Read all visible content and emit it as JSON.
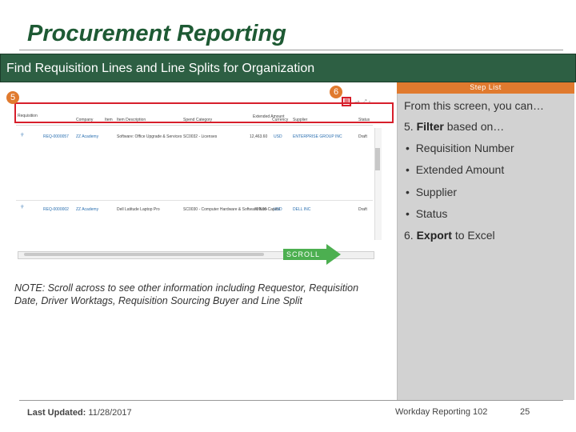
{
  "slide": {
    "title": "Procurement Reporting",
    "banner": "Find Requisition Lines and Line Splits for Organization",
    "step_list_label": "Step List",
    "markers": {
      "five": "5",
      "six": "6"
    },
    "scroll_label": "SCROLL",
    "note": "NOTE: Scroll across to see other information including Requestor, Requisition Date, Driver Worktags, Requisition  Sourcing Buyer and Line Split",
    "footer": {
      "updated_label": "Last Updated:",
      "updated_date": "11/28/2017",
      "course": "Workday Reporting 102",
      "page": "25"
    }
  },
  "steps": {
    "intro": "From this screen, you can…",
    "filter_num": "5.",
    "filter_word": "Filter",
    "filter_rest": "based on…",
    "bullets": [
      "Requisition Number",
      "Extended Amount",
      "Supplier",
      "Status"
    ],
    "export_num": "6.",
    "export_word": "Export",
    "export_rest": "to Excel"
  },
  "table": {
    "headers": [
      "Requisition",
      "Company",
      "Item",
      "Item Description",
      "Spend Category",
      "Extended Amount",
      "Currency",
      "Supplier",
      "Status"
    ],
    "rows": [
      [
        "REQ-0000057",
        "ZZ Academy",
        "",
        "Software: Office Upgrade & Services",
        "SC0032 - Licenses",
        "12,463.60",
        "USD",
        "ENTERPRISE GROUP INC",
        "Draft"
      ],
      [
        "REQ-0000002",
        "ZZ Academy",
        "",
        "Dell Latitude Laptop Pro",
        "SC0030 - Computer Hardware & Software Non-Capital",
        "799.00",
        "USD",
        "DELL INC",
        "Draft"
      ]
    ]
  },
  "colors": {
    "title": "#1e5a34",
    "banner": "#2d5f43",
    "accent": "#e07a2e",
    "highlight": "#d71f2b",
    "arrow": "#4caf50",
    "panel": "#d2d2d2"
  }
}
